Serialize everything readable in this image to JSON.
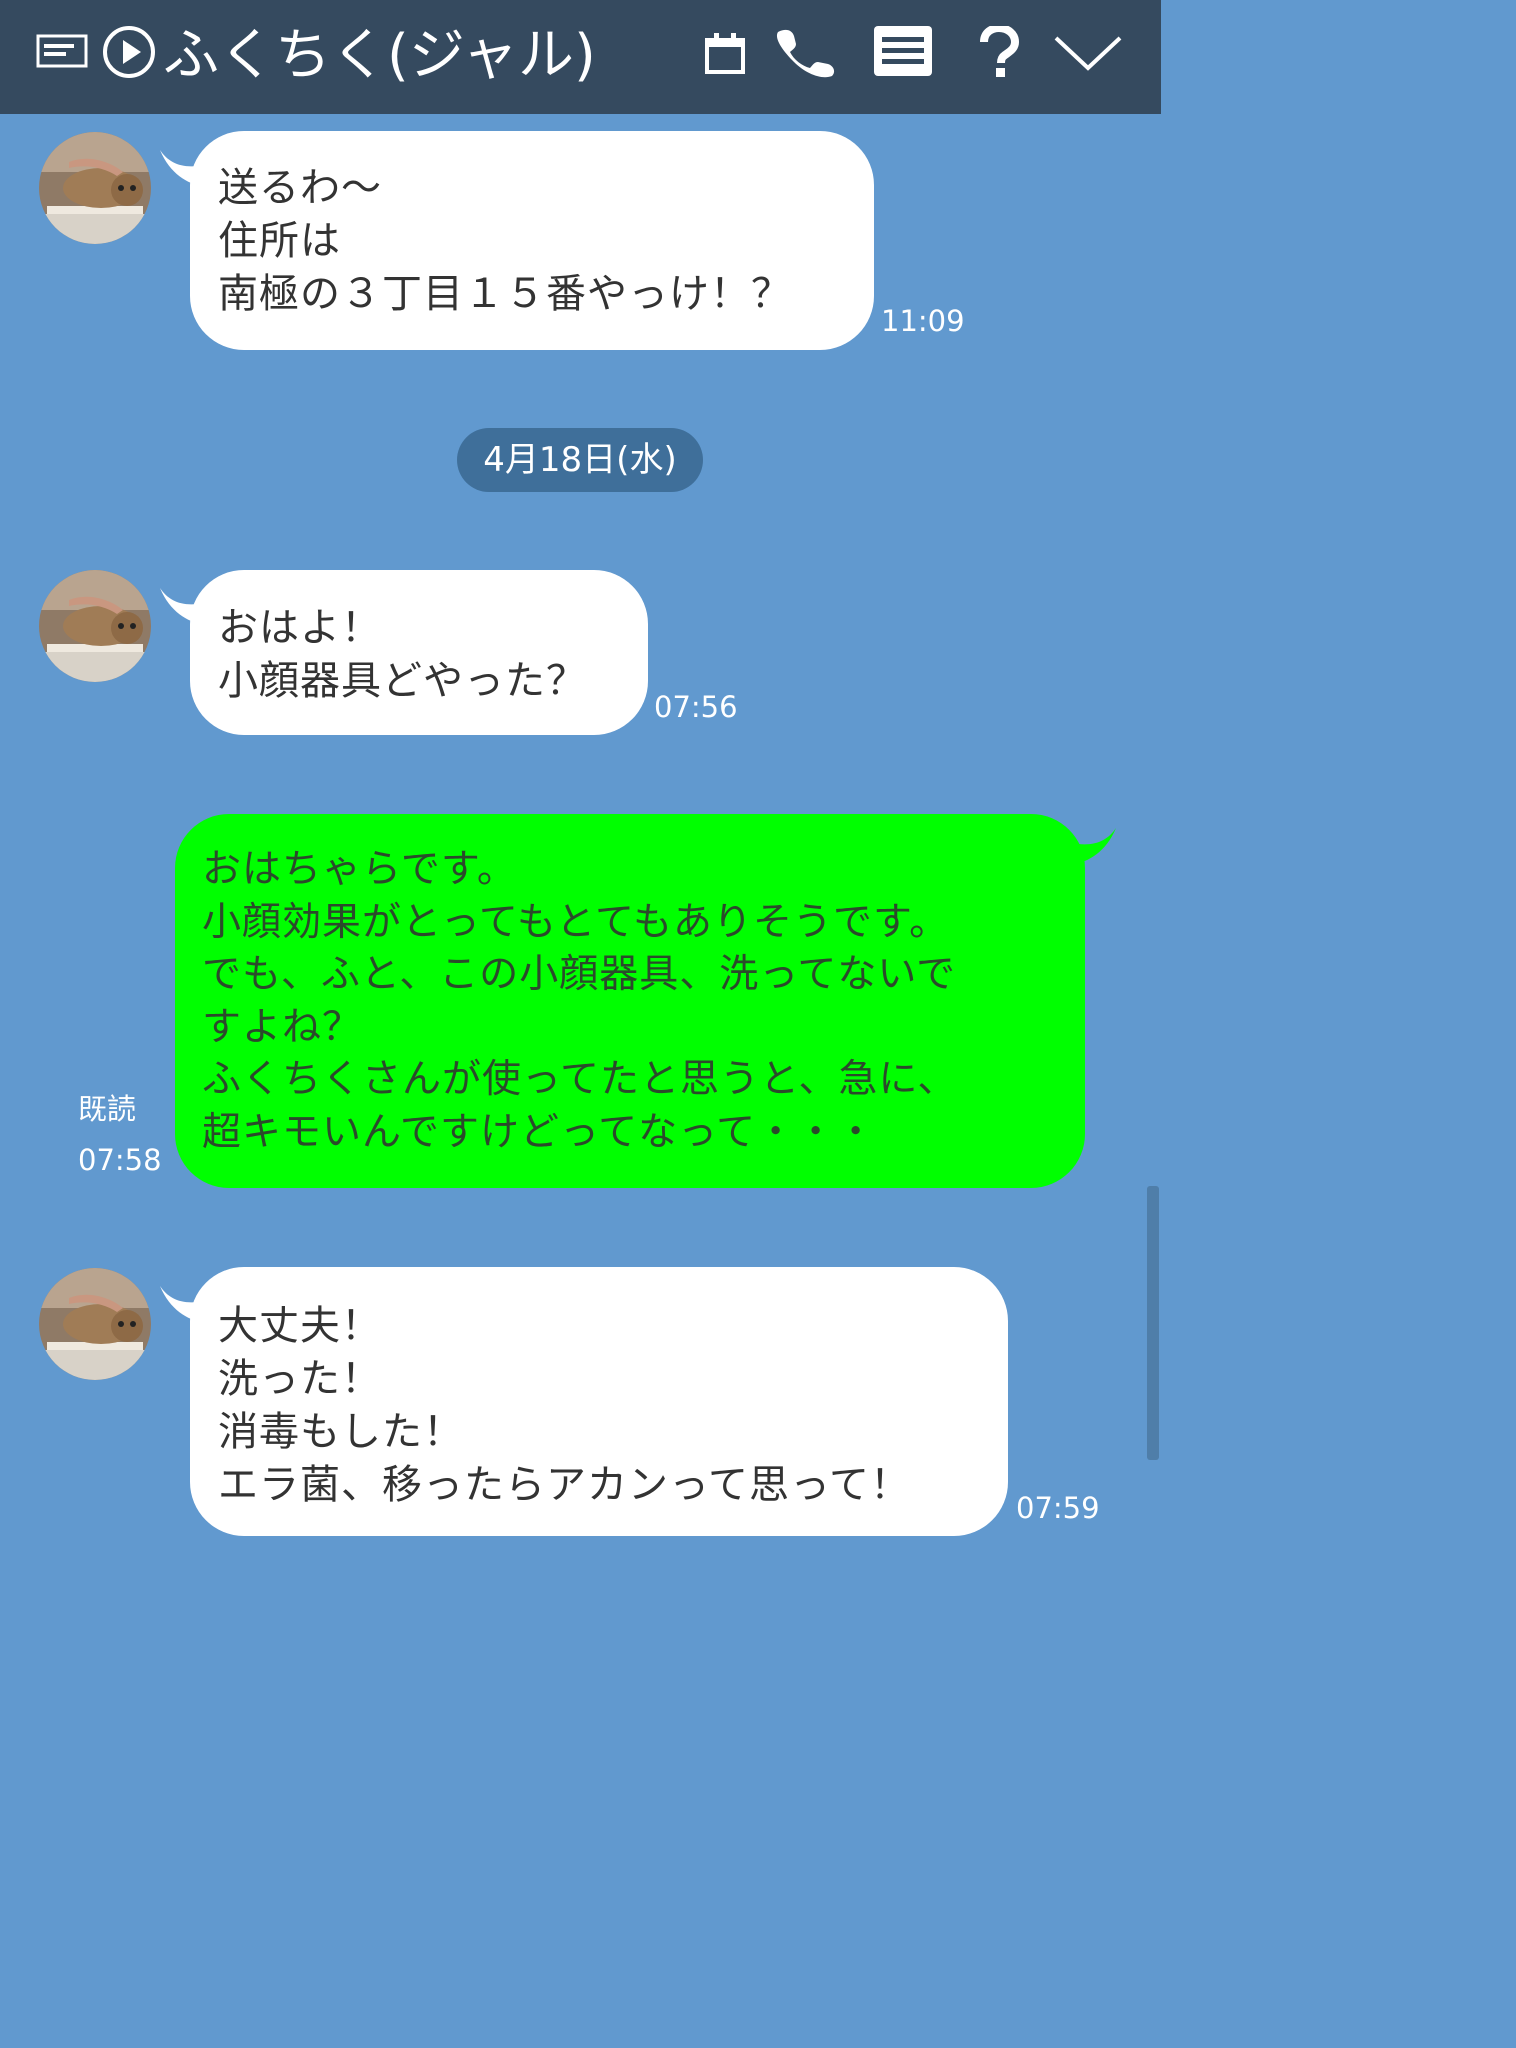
{
  "header": {
    "title": "ふくちく(ジャル)",
    "icons": [
      "keep-icon",
      "play-icon",
      "calendar-icon",
      "phone-icon",
      "menu-icon",
      "help-icon",
      "chevron-down-icon"
    ]
  },
  "messages": [
    {
      "side": "left",
      "text": "送るわ〜\n住所は\n南極の３丁目１５番やっけ！？",
      "time": "11:09"
    },
    {
      "side": "left",
      "text": "おはよ！\n小顔器具どやった？",
      "time": "07:56"
    },
    {
      "side": "right",
      "text": "おはちゃらです。\n小顔効果がとってもとてもありそうです。\nでも、ふと、この小顔器具、洗ってないで\nすよね？\nふくちくさんが使ってたと思うと、急に、\n超キモいんですけどってなって・・・",
      "read": "既読",
      "time": "07:58"
    },
    {
      "side": "left",
      "text": "大丈夫！\n洗った！\n消毒もした！\nエラ菌、移ったらアカンって思って！",
      "time": "07:59"
    }
  ],
  "date_divider": "4月18日(水)",
  "colors": {
    "header_bg": "#354a5f",
    "chat_bg": "#6199cf",
    "my_bubble": "#00ff00",
    "their_bubble": "#ffffff",
    "date_pill": "#3f6f9a"
  }
}
